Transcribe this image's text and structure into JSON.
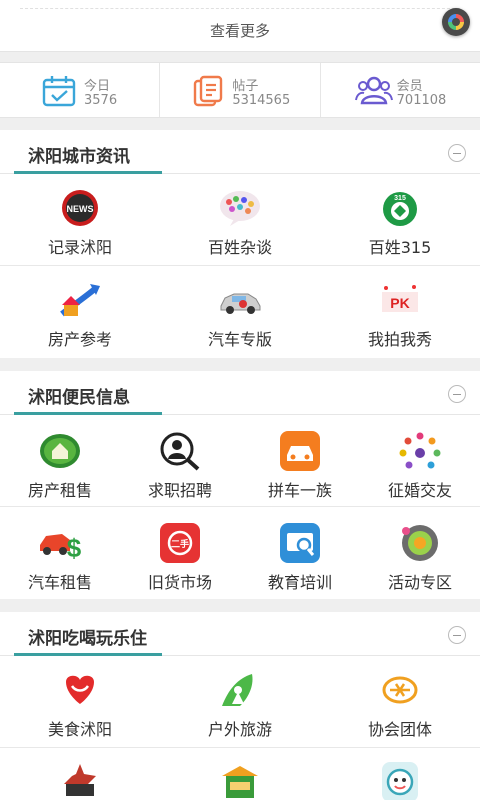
{
  "more": {
    "label": "查看更多"
  },
  "stats": [
    {
      "label": "今日",
      "value": "3576",
      "icon": "calendar-icon",
      "color": "#3aa6d9"
    },
    {
      "label": "帖子",
      "value": "5314565",
      "icon": "document-icon",
      "color": "#f07a4a"
    },
    {
      "label": "会员",
      "value": "701108",
      "icon": "users-icon",
      "color": "#6a5ad0"
    }
  ],
  "sections": [
    {
      "title": "沭阳城市资讯",
      "rows": [
        [
          {
            "label": "记录沭阳",
            "icon": "news-icon"
          },
          {
            "label": "百姓杂谈",
            "icon": "chat-bubble-icon"
          },
          {
            "label": "百姓315",
            "icon": "consumer-315-icon"
          }
        ],
        [
          {
            "label": "房产参考",
            "icon": "house-arrow-icon"
          },
          {
            "label": "汽车专版",
            "icon": "car-icon"
          },
          {
            "label": "我拍我秀",
            "icon": "photo-show-icon"
          }
        ]
      ]
    },
    {
      "title": "沭阳便民信息",
      "rows": [
        [
          {
            "label": "房产租售",
            "icon": "house-badge-icon"
          },
          {
            "label": "求职招聘",
            "icon": "job-search-icon"
          },
          {
            "label": "拼车一族",
            "icon": "carpool-icon"
          },
          {
            "label": "征婚交友",
            "icon": "people-circle-icon"
          }
        ],
        [
          {
            "label": "汽车租售",
            "icon": "car-dollar-icon"
          },
          {
            "label": "旧货市场",
            "icon": "second-hand-icon"
          },
          {
            "label": "教育培训",
            "icon": "education-icon"
          },
          {
            "label": "活动专区",
            "icon": "activity-icon"
          }
        ]
      ]
    },
    {
      "title": "沭阳吃喝玩乐住",
      "rows": [
        [
          {
            "label": "美食沭阳",
            "icon": "food-icon"
          },
          {
            "label": "户外旅游",
            "icon": "travel-icon"
          },
          {
            "label": "协会团体",
            "icon": "association-icon"
          }
        ],
        [
          {
            "label": "",
            "icon": "landmark-icon"
          },
          {
            "label": "",
            "icon": "shop-icon"
          },
          {
            "label": "",
            "icon": "mascot-icon"
          }
        ]
      ]
    }
  ]
}
